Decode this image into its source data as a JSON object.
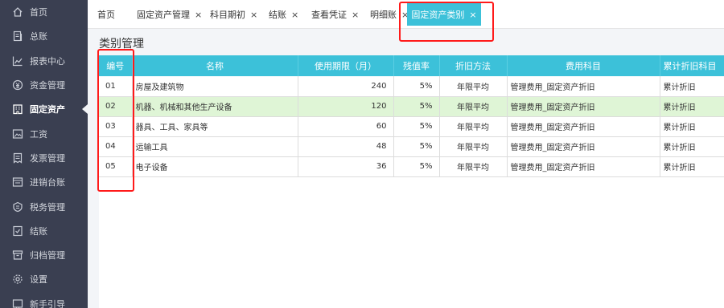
{
  "sidebar": {
    "items": [
      {
        "label": "首页",
        "icon": "home-icon"
      },
      {
        "label": "总账",
        "icon": "ledger-icon"
      },
      {
        "label": "报表中心",
        "icon": "report-chart-icon"
      },
      {
        "label": "资金管理",
        "icon": "money-icon"
      },
      {
        "label": "固定资产",
        "icon": "building-icon",
        "active": true
      },
      {
        "label": "工资",
        "icon": "wage-image-icon"
      },
      {
        "label": "发票管理",
        "icon": "invoice-icon"
      },
      {
        "label": "进销台账",
        "icon": "inventory-icon"
      },
      {
        "label": "税务管理",
        "icon": "tax-icon"
      },
      {
        "label": "结账",
        "icon": "checkout-icon"
      },
      {
        "label": "归档管理",
        "icon": "archive-icon"
      },
      {
        "label": "设置",
        "icon": "gear-icon"
      },
      {
        "label": "新手引导",
        "icon": "guide-icon"
      }
    ]
  },
  "tabs": [
    {
      "label": "首页",
      "closable": false
    },
    {
      "label": "固定资产管理",
      "closable": true
    },
    {
      "label": "科目期初",
      "closable": true
    },
    {
      "label": "结账",
      "closable": true
    },
    {
      "label": "查看凭证",
      "closable": true
    },
    {
      "label": "明细账",
      "closable": true
    },
    {
      "label": "固定资产类别",
      "closable": true,
      "active": true
    }
  ],
  "close_glyph": "×",
  "page_title": "类别管理",
  "table": {
    "headers": [
      "编号",
      "名称",
      "使用期限（月）",
      "残值率",
      "折旧方法",
      "费用科目",
      "累计折旧科目"
    ],
    "rows": [
      {
        "code": "01",
        "name": "房屋及建筑物",
        "months": "240",
        "residual": "5%",
        "method": "年限平均",
        "expense": "管理费用_固定资产折旧",
        "accum": "累计折旧"
      },
      {
        "code": "02",
        "name": "机器、机械和其他生产设备",
        "months": "120",
        "residual": "5%",
        "method": "年限平均",
        "expense": "管理费用_固定资产折旧",
        "accum": "累计折旧",
        "selected": true
      },
      {
        "code": "03",
        "name": "器具、工具、家具等",
        "months": "60",
        "residual": "5%",
        "method": "年限平均",
        "expense": "管理费用_固定资产折旧",
        "accum": "累计折旧"
      },
      {
        "code": "04",
        "name": "运输工具",
        "months": "48",
        "residual": "5%",
        "method": "年限平均",
        "expense": "管理费用_固定资产折旧",
        "accum": "累计折旧"
      },
      {
        "code": "05",
        "name": "电子设备",
        "months": "36",
        "residual": "5%",
        "method": "年限平均",
        "expense": "管理费用_固定资产折旧",
        "accum": "累计折旧"
      }
    ]
  },
  "colors": {
    "sidebar_bg": "#3a3f51",
    "accent": "#3cc1d9",
    "selected_row": "#dff5d6",
    "highlight_box": "#ff1a1a"
  }
}
